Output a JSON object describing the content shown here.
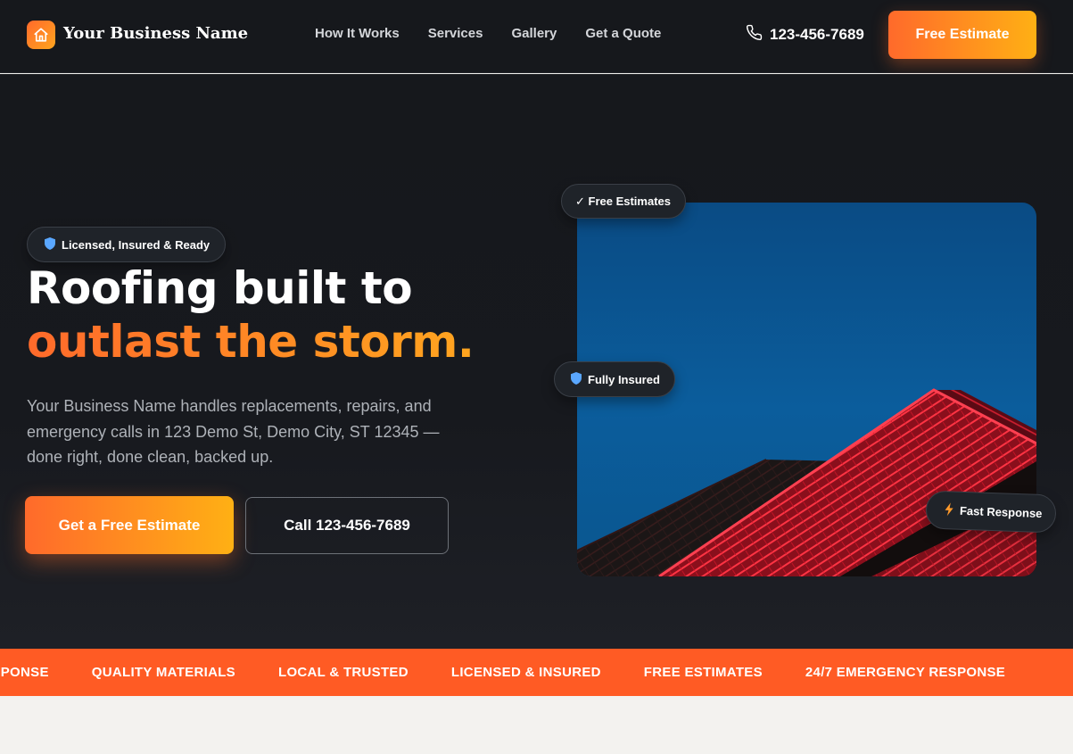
{
  "header": {
    "brand_name": "Your Business Name",
    "logo_icon": "home-icon",
    "nav": [
      "How It Works",
      "Services",
      "Gallery",
      "Get a Quote"
    ],
    "phone": "123-456-7689",
    "phone_icon": "phone-icon",
    "estimate_button": "Free Estimate"
  },
  "hero": {
    "badge": "Licensed, Insured & Ready",
    "badge_icon": "shield-icon",
    "headline_line1": "Roofing built to",
    "headline_line2": "outlast the storm.",
    "description": "Your Business Name handles replacements, repairs, and emergency calls in 123 Demo St, Demo City, ST 12345 — done right, done clean, backed up.",
    "cta_primary": "Get a Free Estimate",
    "cta_secondary": "Call 123-456-7689",
    "floating_badges": {
      "free_estimates": "✓ Free Estimates",
      "fully_insured": "Fully Insured",
      "fast_response": "Fast Response"
    }
  },
  "ticker": [
    "RESPONSE",
    "QUALITY MATERIALS",
    "LOCAL & TRUSTED",
    "LICENSED & INSURED",
    "FREE ESTIMATES",
    "24/7 EMERGENCY RESPONSE"
  ],
  "colors": {
    "accent_start": "#ff6a2b",
    "accent_end": "#ffb014",
    "ticker_bg": "#ff5b24",
    "dark_bg": "#16181c"
  }
}
